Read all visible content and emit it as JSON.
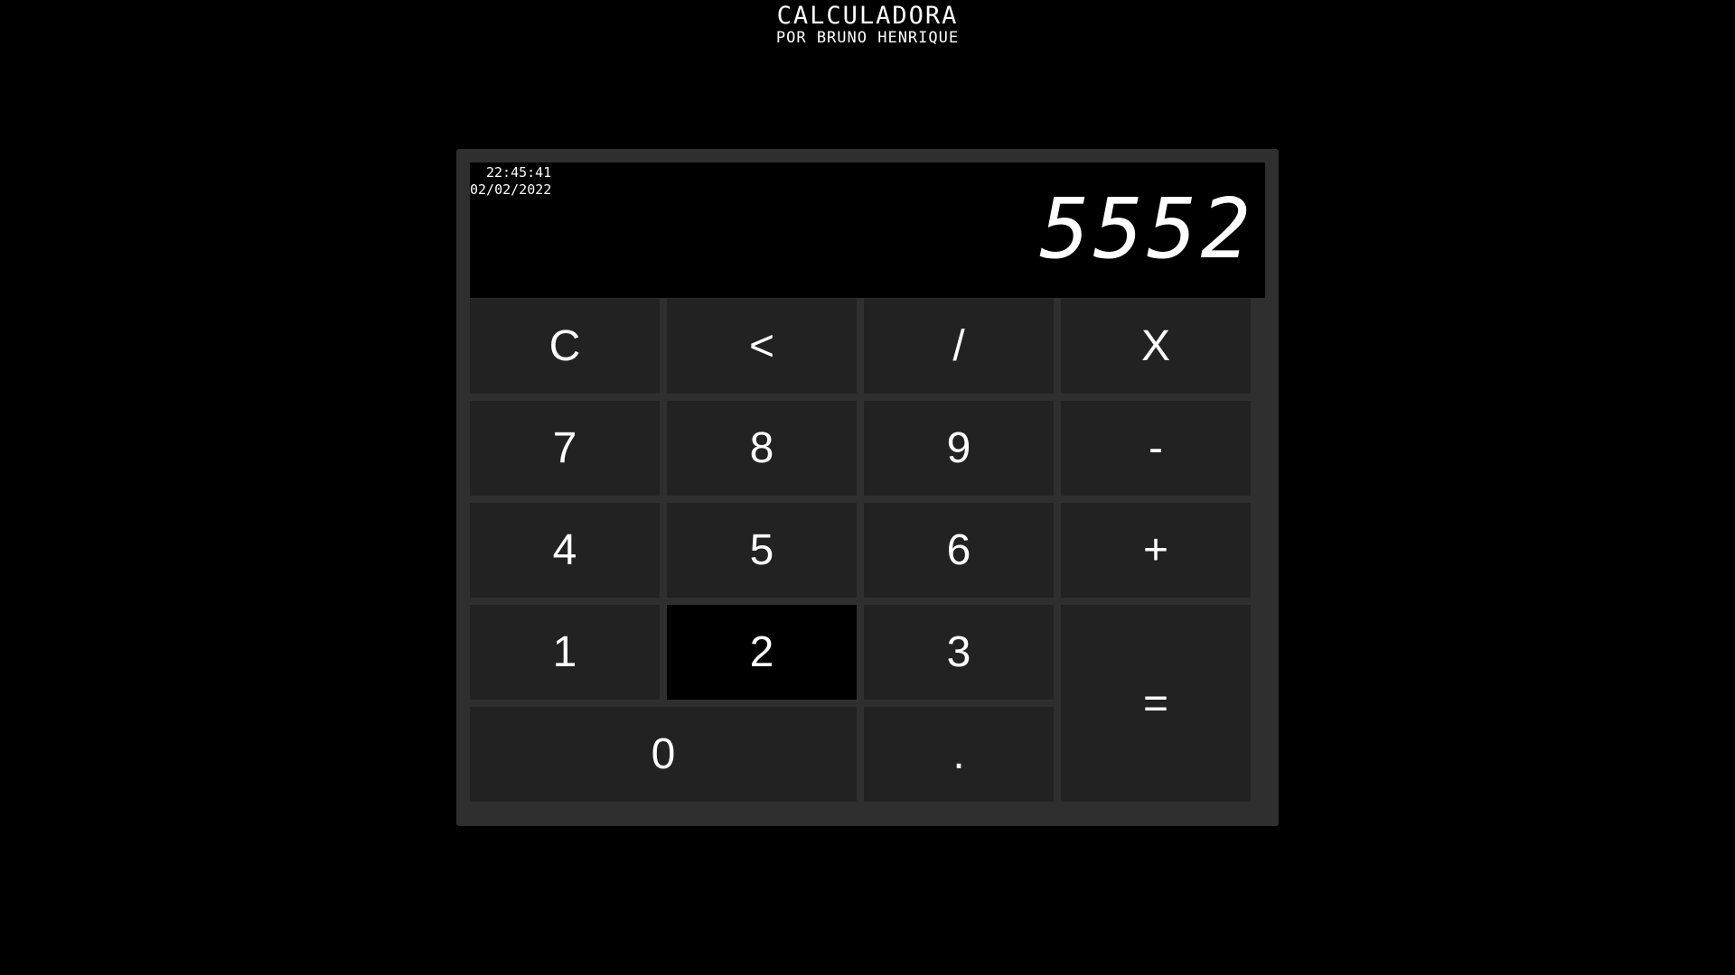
{
  "header": {
    "title": "CALCULADORA",
    "subtitle": "POR BRUNO HENRIQUE"
  },
  "display": {
    "time": "22:45:41",
    "date": "02/02/2022",
    "value": "5552"
  },
  "keys": {
    "clear": "C",
    "backspace": "<",
    "divide": "/",
    "multiply": "X",
    "seven": "7",
    "eight": "8",
    "nine": "9",
    "minus": "-",
    "four": "4",
    "five": "5",
    "six": "6",
    "plus": "+",
    "one": "1",
    "two": "2",
    "three": "3",
    "equals": "=",
    "zero": "0",
    "decimal": "."
  },
  "colors": {
    "page_background": "#000000",
    "calculator_body": "#2f2f2f",
    "key_background": "#222222",
    "key_pressed": "#000000",
    "text": "#ffffff"
  }
}
